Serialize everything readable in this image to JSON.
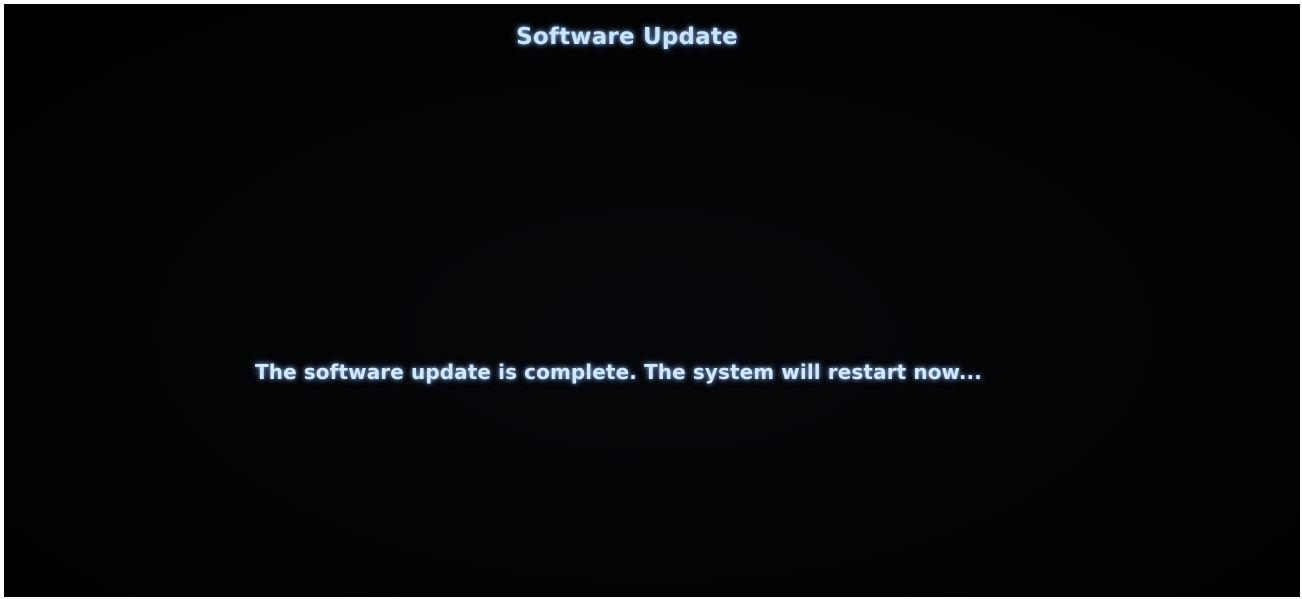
{
  "screen": {
    "title": "Software Update",
    "message": "The software update is complete. The system will restart now..."
  },
  "colors": {
    "background": "#000000",
    "text": "#c9e4ff",
    "glow": "#78b4ff",
    "border": "#ffffff"
  }
}
